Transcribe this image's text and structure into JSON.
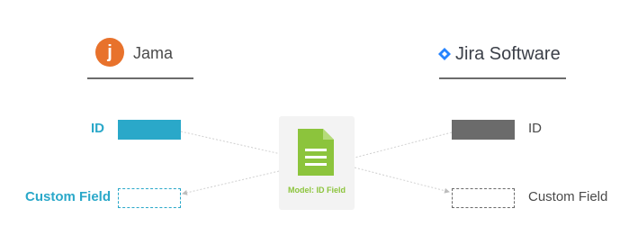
{
  "left_system": {
    "logo_letter": "j",
    "logo_color": "#e8722c",
    "name": "Jama",
    "fields": [
      {
        "label": "ID",
        "style": "filled"
      },
      {
        "label": "Custom Field",
        "style": "dashed"
      }
    ],
    "accent": "#2aa8c9"
  },
  "right_system": {
    "name": "Jira Software",
    "icon": "jira-diamond-icon",
    "icon_color": "#2684ff",
    "fields": [
      {
        "label": "ID",
        "style": "filled"
      },
      {
        "label": "Custom Field",
        "style": "dashed"
      }
    ],
    "accent": "#6b6b6b"
  },
  "model": {
    "label": "Model: ID Field",
    "icon": "document-icon",
    "color": "#8cc43c"
  }
}
